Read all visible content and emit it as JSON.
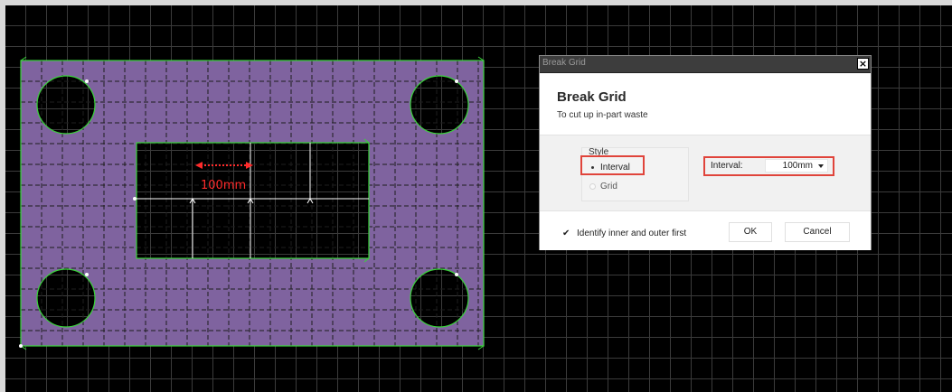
{
  "drawing": {
    "dimension_label": "100mm",
    "colors": {
      "canvas": "#000000",
      "grid_line": "#3b3b3b",
      "part_fill": "#7f639f",
      "contour": "#39d439",
      "dashed_grid": "#1e1e1e",
      "interval_line": "#ffffff",
      "dimension_arrow": "#ff2b2b"
    }
  },
  "dialog": {
    "window_title": "Break Grid",
    "close_glyph": "×",
    "heading": "Break Grid",
    "subheading": "To cut up in-part waste",
    "style_group": {
      "label": "Style",
      "options": [
        {
          "label": "Interval",
          "selected": true
        },
        {
          "label": "Grid",
          "selected": false
        }
      ]
    },
    "interval": {
      "label": "Interval:",
      "value": "100mm"
    },
    "identify_checkbox": {
      "label": "Identify inner and outer first",
      "checked": true,
      "glyph": "✔"
    },
    "ok_label": "OK",
    "cancel_label": "Cancel",
    "highlight_color": "#e0443b"
  }
}
